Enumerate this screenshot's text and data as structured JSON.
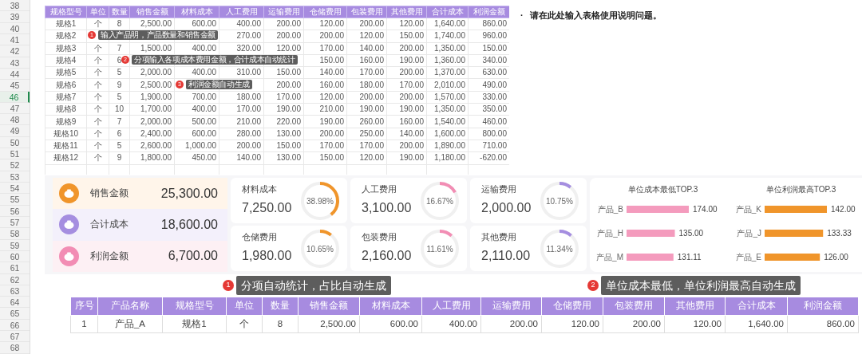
{
  "row_numbers": [
    {
      "label": "38",
      "selected": false
    },
    {
      "label": "39",
      "selected": false
    },
    {
      "label": "40",
      "selected": false
    },
    {
      "label": "41",
      "selected": false
    },
    {
      "label": "42",
      "selected": false
    },
    {
      "label": "43",
      "selected": false
    },
    {
      "label": "44",
      "selected": false
    },
    {
      "label": "45",
      "selected": false
    },
    {
      "label": "46",
      "selected": true
    },
    {
      "label": "47",
      "selected": false
    },
    {
      "label": "48",
      "selected": false
    },
    {
      "label": "49",
      "selected": false
    },
    {
      "label": "50",
      "selected": false
    },
    {
      "label": "51",
      "selected": false
    },
    {
      "label": "52",
      "selected": false
    },
    {
      "label": "53",
      "selected": false
    },
    {
      "label": "54",
      "selected": false
    },
    {
      "label": "55",
      "selected": false
    },
    {
      "label": "56",
      "selected": false
    },
    {
      "label": "57",
      "selected": false
    },
    {
      "label": "58",
      "selected": false
    },
    {
      "label": "59",
      "selected": false
    },
    {
      "label": "60",
      "selected": false
    },
    {
      "label": "61",
      "selected": false
    },
    {
      "label": "62",
      "selected": false
    },
    {
      "label": "63",
      "selected": false
    },
    {
      "label": "64",
      "selected": false
    },
    {
      "label": "65",
      "selected": false
    },
    {
      "label": "66",
      "selected": false
    },
    {
      "label": "67",
      "selected": false
    },
    {
      "label": "68",
      "selected": false
    }
  ],
  "source_table": {
    "columns": [
      "规格型号",
      "单位",
      "数量",
      "销售金额",
      "材料成本",
      "人工费用",
      "运输费用",
      "仓储费用",
      "包装费用",
      "其他费用",
      "合计成本",
      "利润金额"
    ],
    "rows": [
      [
        "规格1",
        "个",
        "8",
        "2,500.00",
        "600.00",
        "400.00",
        "200.00",
        "120.00",
        "200.00",
        "120.00",
        "1,640.00",
        "860.00"
      ],
      [
        "规格2",
        null,
        null,
        null,
        null,
        "270.00",
        "200.00",
        "200.00",
        "120.00",
        "150.00",
        "1,740.00",
        "960.00"
      ],
      [
        "规格3",
        "个",
        "7",
        "1,500.00",
        "400.00",
        "320.00",
        "120.00",
        "170.00",
        "140.00",
        "200.00",
        "1,350.00",
        "150.00"
      ],
      [
        "规格4",
        "个",
        "6",
        null,
        null,
        null,
        null,
        "150.00",
        "160.00",
        "190.00",
        "1,360.00",
        "340.00"
      ],
      [
        "规格5",
        "个",
        "5",
        "2,000.00",
        "400.00",
        "310.00",
        "150.00",
        "140.00",
        "170.00",
        "200.00",
        "1,370.00",
        "630.00"
      ],
      [
        "规格6",
        "个",
        "9",
        "2,500.00",
        null,
        null,
        "200.00",
        "160.00",
        "180.00",
        "170.00",
        "2,010.00",
        "490.00"
      ],
      [
        "规格7",
        "个",
        "5",
        "1,900.00",
        "700.00",
        "180.00",
        "170.00",
        "120.00",
        "200.00",
        "200.00",
        "1,570.00",
        "330.00"
      ],
      [
        "规格8",
        "个",
        "10",
        "1,700.00",
        "400.00",
        "170.00",
        "190.00",
        "210.00",
        "190.00",
        "190.00",
        "1,350.00",
        "350.00"
      ],
      [
        "规格9",
        "个",
        "7",
        "2,000.00",
        "500.00",
        "210.00",
        "220.00",
        "190.00",
        "260.00",
        "160.00",
        "1,540.00",
        "460.00"
      ],
      [
        "规格10",
        "个",
        "6",
        "2,400.00",
        "600.00",
        "280.00",
        "130.00",
        "200.00",
        "250.00",
        "140.00",
        "1,600.00",
        "800.00"
      ],
      [
        "规格11",
        "个",
        "5",
        "2,600.00",
        "1,000.00",
        "200.00",
        "150.00",
        "170.00",
        "170.00",
        "200.00",
        "1,890.00",
        "710.00"
      ],
      [
        "规格12",
        "个",
        "9",
        "1,800.00",
        "450.00",
        "140.00",
        "130.00",
        "150.00",
        "120.00",
        "190.00",
        "1,180.00",
        "-620.00"
      ]
    ]
  },
  "source_callouts": [
    {
      "number": "1",
      "text": "输入产品明，产品数量和销售金额"
    },
    {
      "number": "2",
      "text": "分项输入各项成本费用金额，合计成本自动统计"
    },
    {
      "number": "3",
      "text": "利润金额自动生成"
    }
  ],
  "note": {
    "bullet": "·",
    "text": "请在此处输入表格使用说明问题。"
  },
  "summary": [
    {
      "label": "销售金额",
      "value": "25,300.00",
      "color": "#f0952b"
    },
    {
      "label": "合计成本",
      "value": "18,600.00",
      "color": "#a58ee0"
    },
    {
      "label": "利润金额",
      "value": "6,700.00",
      "color": "#f28db4"
    }
  ],
  "cost_cards": [
    {
      "label": "材料成本",
      "value": "7,250.00",
      "percent": "38.98%",
      "level": 0.3898,
      "color": "#f0952b"
    },
    {
      "label": "人工费用",
      "value": "3,100.00",
      "percent": "16.67%",
      "level": 0.1667,
      "color": "#f28db4"
    },
    {
      "label": "运输费用",
      "value": "2,000.00",
      "percent": "10.75%",
      "level": 0.1075,
      "color": "#a58ee0"
    },
    {
      "label": "仓储费用",
      "value": "1,980.00",
      "percent": "10.65%",
      "level": 0.1065,
      "color": "#f0952b"
    },
    {
      "label": "包装费用",
      "value": "2,160.00",
      "percent": "11.61%",
      "level": 0.1161,
      "color": "#f28db4"
    },
    {
      "label": "其他费用",
      "value": "2,110.00",
      "percent": "11.34%",
      "level": 0.1134,
      "color": "#a58ee0"
    }
  ],
  "rankings": [
    {
      "chart_data": {
        "type": "bar",
        "orientation": "horizontal",
        "title": "单位成本最低TOP.3",
        "categories": [
          "产品_B",
          "产品_H",
          "产品_M"
        ],
        "series": [
          {
            "color": "#f49bbd",
            "values": [
              174.0,
              135.0,
              131.11
            ],
            "value_labels": [
              "174.00",
              "135.00",
              "131.11"
            ]
          }
        ],
        "data_labels": true
      }
    },
    {
      "chart_data": {
        "type": "bar",
        "orientation": "horizontal",
        "title": "单位利润最高TOP.3",
        "categories": [
          "产品_K",
          "产品_J",
          "产品_E"
        ],
        "series": [
          {
            "color": "#f0952b",
            "values": [
              142.0,
              133.33,
              126.0
            ],
            "value_labels": [
              "142.00",
              "133.33",
              "126.00"
            ]
          }
        ],
        "data_labels": true
      }
    }
  ],
  "dashboard_callouts": [
    {
      "number": "1",
      "text": "分项自动统计，占比自动生成"
    },
    {
      "number": "2",
      "text": "单位成本最低，单位利润最高自动生成"
    }
  ],
  "detail_table": {
    "columns": [
      "序号",
      "产品名称",
      "规格型号",
      "单位",
      "数量",
      "销售金额",
      "材料成本",
      "人工费用",
      "运输费用",
      "仓储费用",
      "包装费用",
      "其他费用",
      "合计成本",
      "利润金额"
    ],
    "rows": [
      [
        "1",
        "产品_A",
        "规格1",
        "个",
        "8",
        "2,500.00",
        "600.00",
        "400.00",
        "200.00",
        "120.00",
        "200.00",
        "120.00",
        "1,640.00",
        "860.00"
      ]
    ]
  }
}
